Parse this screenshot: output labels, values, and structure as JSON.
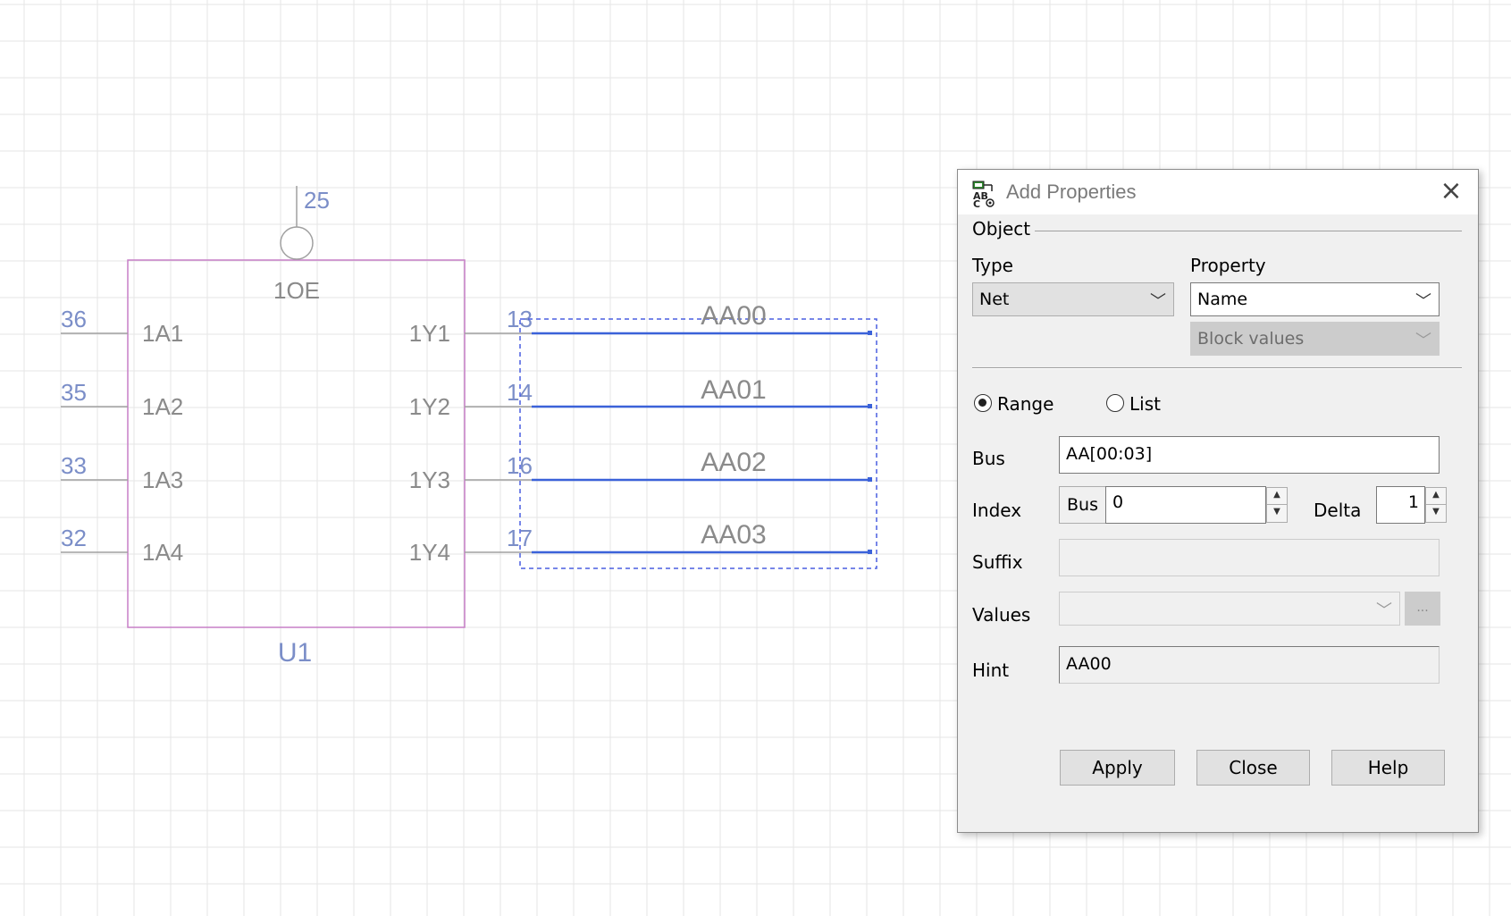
{
  "schematic": {
    "part": {
      "refdes": "U1",
      "enable_pin": {
        "name": "1OE",
        "number": "25"
      },
      "pins_left": [
        {
          "name": "1A1",
          "number": "36"
        },
        {
          "name": "1A2",
          "number": "35"
        },
        {
          "name": "1A3",
          "number": "33"
        },
        {
          "name": "1A4",
          "number": "32"
        }
      ],
      "pins_right": [
        {
          "name": "1Y1",
          "number": "13"
        },
        {
          "name": "1Y2",
          "number": "14"
        },
        {
          "name": "1Y3",
          "number": "16"
        },
        {
          "name": "1Y4",
          "number": "17"
        }
      ]
    },
    "nets": [
      "AA00",
      "AA01",
      "AA02",
      "AA03"
    ],
    "colors": {
      "grid": "#e6e6e6",
      "part_outline": "#c77fc7",
      "pin_line": "#a0a0a0",
      "pin_number": "#7b8ec8",
      "wire": "#3b62d9",
      "selection": "#4a5fe0"
    }
  },
  "dialog": {
    "title": "Add Properties",
    "title_icon": "add-properties-icon",
    "close_icon": "close-icon",
    "object_group": "Object",
    "type_label": "Type",
    "type_value": "Net",
    "property_label": "Property",
    "property_value": "Name",
    "block_values": "Block values",
    "range_label": "Range",
    "list_label": "List",
    "range_selected": true,
    "bus_label": "Bus",
    "bus_value": "AA[00:03]",
    "index_label": "Index",
    "index_prefix": "Bus",
    "index_value": "0",
    "delta_label": "Delta",
    "delta_value": "1",
    "suffix_label": "Suffix",
    "suffix_value": "",
    "values_label": "Values",
    "values_value": "",
    "ellipsis": "...",
    "hint_label": "Hint",
    "hint_value": "AA00",
    "apply_button": "Apply",
    "close_button": "Close",
    "help_button": "Help"
  }
}
